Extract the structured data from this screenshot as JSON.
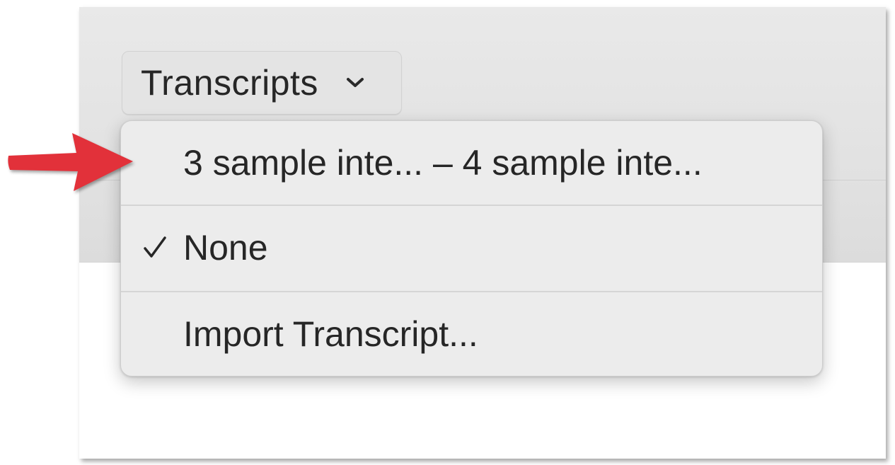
{
  "popup": {
    "label": "Transcripts",
    "chevron_icon": "chevron-down-icon"
  },
  "menu": {
    "items": [
      {
        "label": "3 sample inte... – 4 sample inte...",
        "checked": false
      },
      {
        "label": "None",
        "checked": true
      },
      {
        "label": "Import Transcript...",
        "checked": false
      }
    ],
    "check_icon": "checkmark-icon"
  },
  "annotation": {
    "arrow_icon": "red-pointer-arrow-icon",
    "arrow_color": "#e2313a"
  },
  "colors": {
    "menu_background": "#ececec",
    "toolbar_background": "#e2e2e2",
    "text": "#262626"
  }
}
